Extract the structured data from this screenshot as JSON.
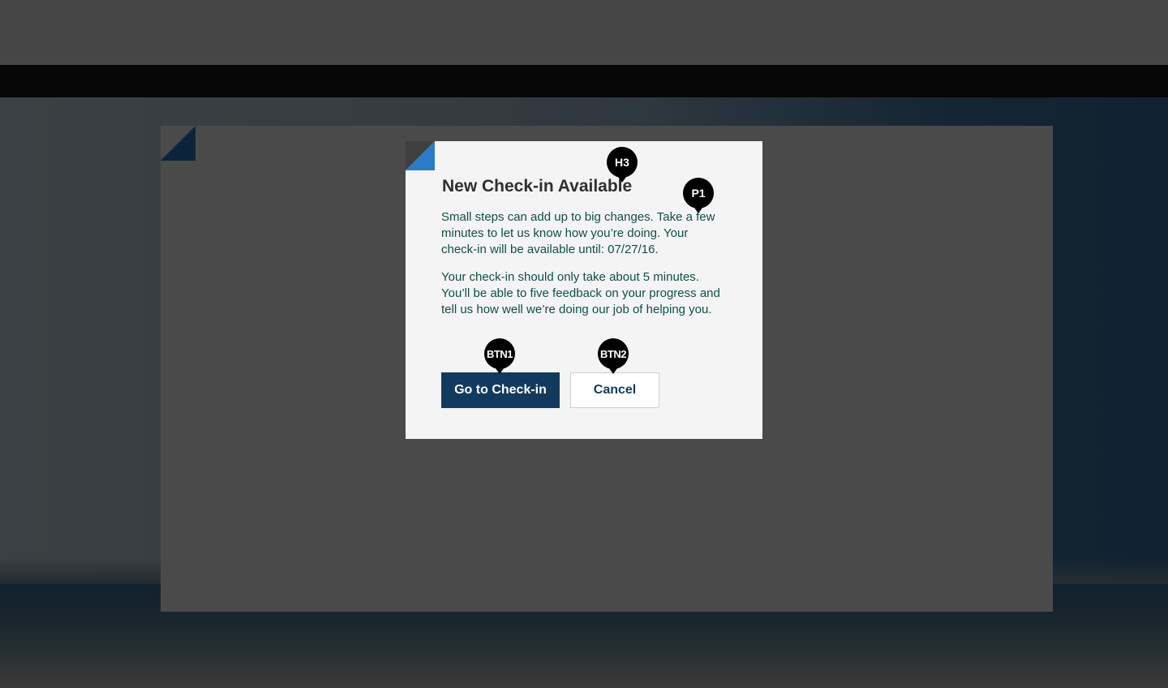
{
  "modal": {
    "title": "New Check-in Available",
    "paragraph1": "Small steps can add up to big changes.  Take a few minutes to let us know how you’re doing.  Your check-in will be available until: 07/27/16.",
    "paragraph2": "Your check-in should only take about 5 minutes. You’ll be able to five feedback on your progress and tell us how well we’re doing our job of helping you.",
    "primary_button": "Go to Check-in",
    "secondary_button": "Cancel"
  },
  "markers": {
    "h3": "H3",
    "p1": "P1",
    "btn1": "BTN1",
    "btn2": "BTN2"
  },
  "colors": {
    "accent": "#2b7bc6",
    "primary_button": "#123a5e",
    "body_text": "#0f4f4a",
    "overlay": "rgba(0,0,0,0.7)"
  }
}
